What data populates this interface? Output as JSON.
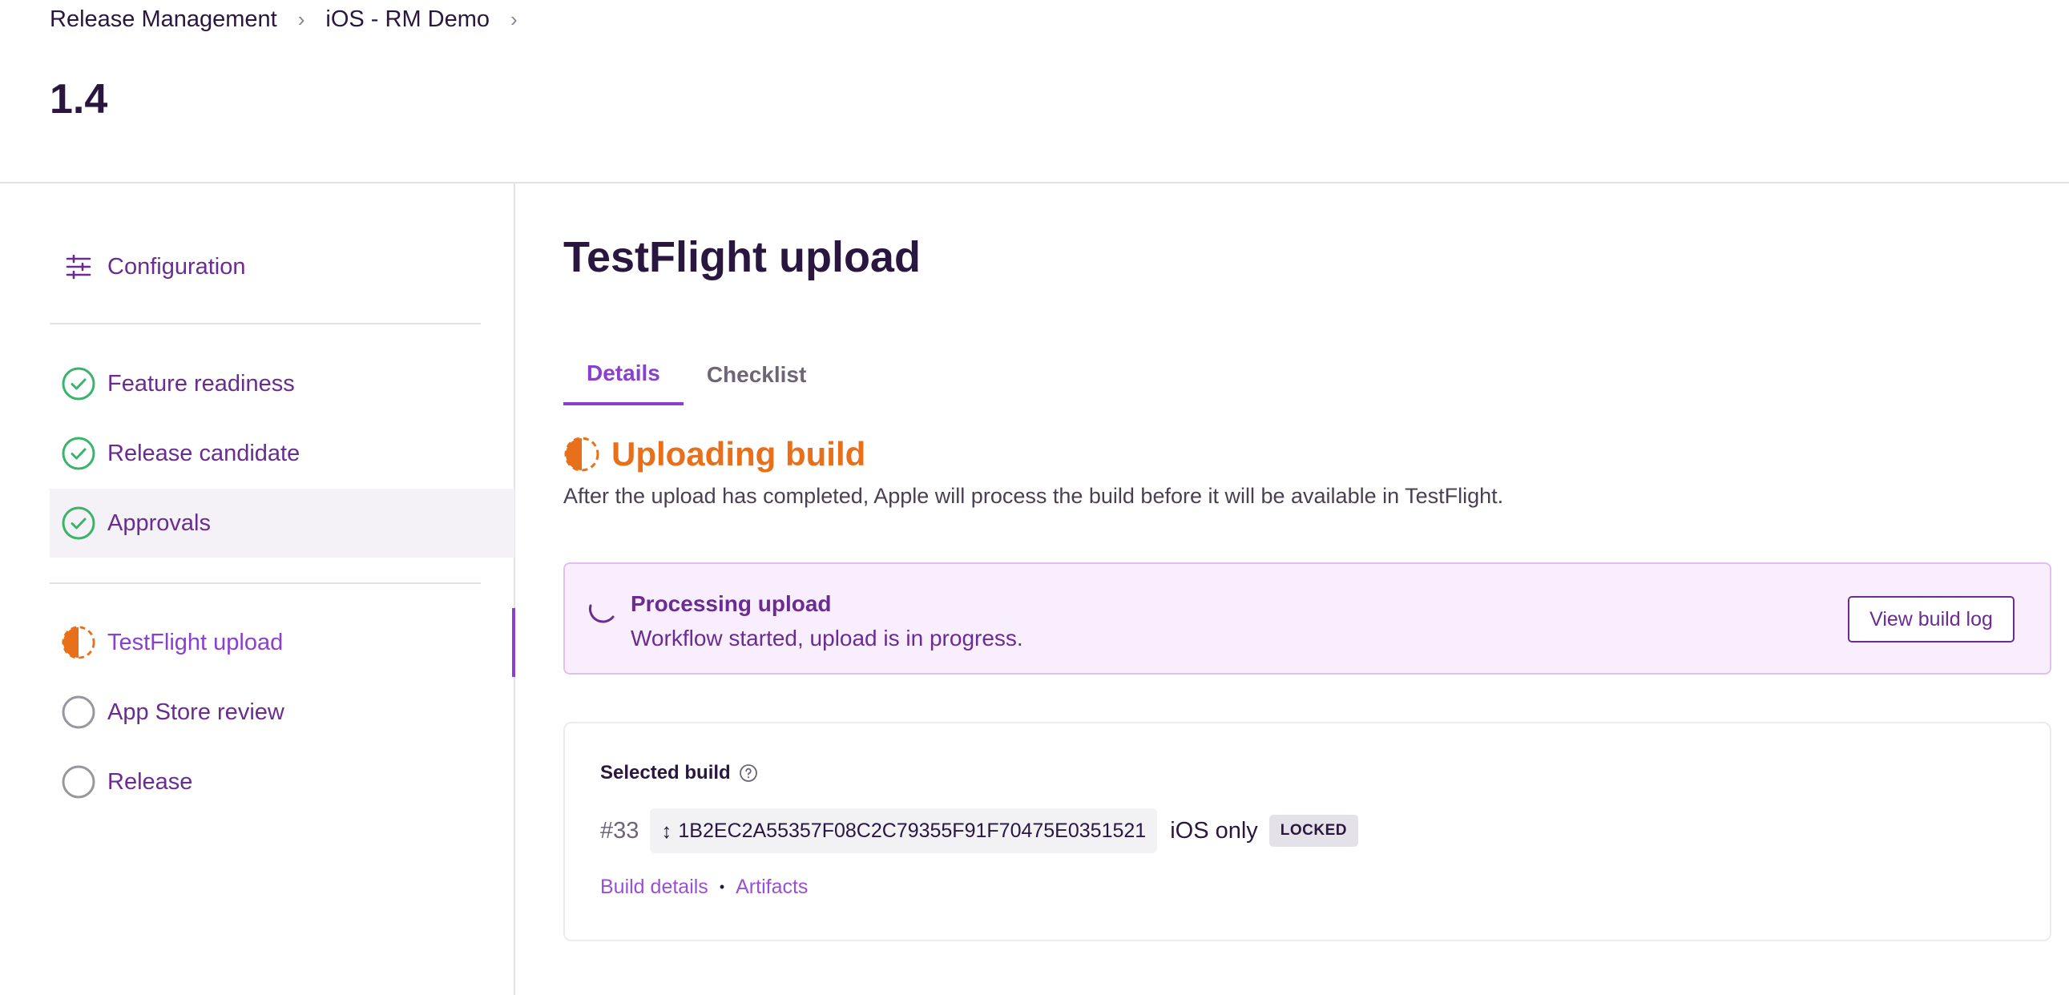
{
  "breadcrumb": {
    "items": [
      "Release Management",
      "iOS - RM Demo"
    ],
    "separator": "›"
  },
  "page": {
    "version": "1.4"
  },
  "sidebar": {
    "configuration_label": "Configuration",
    "steps_group_1": [
      {
        "label": "Feature readiness",
        "status": "complete"
      },
      {
        "label": "Release candidate",
        "status": "complete"
      },
      {
        "label": "Approvals",
        "status": "complete"
      }
    ],
    "steps_group_2": [
      {
        "label": "TestFlight upload",
        "status": "in-progress"
      },
      {
        "label": "App Store review",
        "status": "pending"
      },
      {
        "label": "Release",
        "status": "pending"
      }
    ]
  },
  "main": {
    "title": "TestFlight upload",
    "tabs": [
      {
        "label": "Details",
        "selected": true
      },
      {
        "label": "Checklist",
        "selected": false
      }
    ],
    "status": {
      "heading": "Uploading build",
      "description": "After the upload has completed, Apple will process the build before it will be available in TestFlight."
    },
    "progress": {
      "title": "Processing upload",
      "text": "Workflow started, upload is in progress.",
      "button_label": "View build log"
    },
    "build": {
      "label": "Selected build",
      "number": "#33",
      "commit": "1B2EC2A55357F08C2C79355F91F70475E0351521",
      "platform": "iOS only",
      "badge": "LOCKED",
      "links": [
        "Build details",
        "Artifacts"
      ]
    }
  },
  "colors": {
    "accent": "#8a3fd1",
    "text_dark": "#2a1740",
    "success": "#3bb36a",
    "in_progress": "#e8701a",
    "banner_bg": "#f9eefe"
  },
  "icons": {
    "configuration": "sliders-icon",
    "complete": "check-circle-icon",
    "in_progress": "half-circle-progress-icon",
    "pending": "empty-circle-icon",
    "spinner": "spinner-icon",
    "help": "help-circle-icon",
    "commit": "up-down-arrow-icon"
  }
}
